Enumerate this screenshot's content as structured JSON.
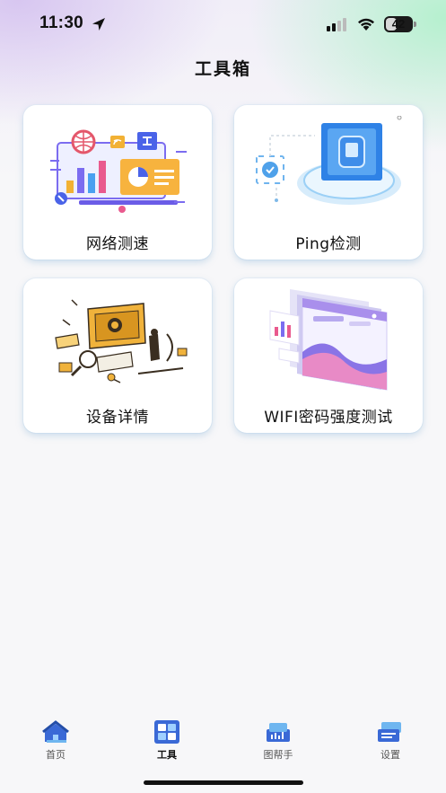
{
  "status_bar": {
    "time": "11:30",
    "battery": "42",
    "battery_level": 0.42
  },
  "header": {
    "title": "工具箱"
  },
  "tools": [
    {
      "label": "网络测速",
      "icon": "network-speed-illustration"
    },
    {
      "label": "Ping检测",
      "icon": "ping-monitor-illustration"
    },
    {
      "label": "设备详情",
      "icon": "device-details-illustration"
    },
    {
      "label": "WIFI密码强度测试",
      "icon": "wifi-password-illustration"
    }
  ],
  "tabbar": {
    "active": "工具",
    "items": [
      {
        "label": "首页",
        "icon": "home-icon"
      },
      {
        "label": "工具",
        "icon": "tools-icon"
      },
      {
        "label": "图帮手",
        "icon": "chart-helper-icon"
      },
      {
        "label": "设置",
        "icon": "settings-icon"
      }
    ]
  },
  "colors": {
    "accent_blue": "#3b7be8",
    "card_shadow": "#9cc6e6",
    "background": "#f7f7f9"
  }
}
